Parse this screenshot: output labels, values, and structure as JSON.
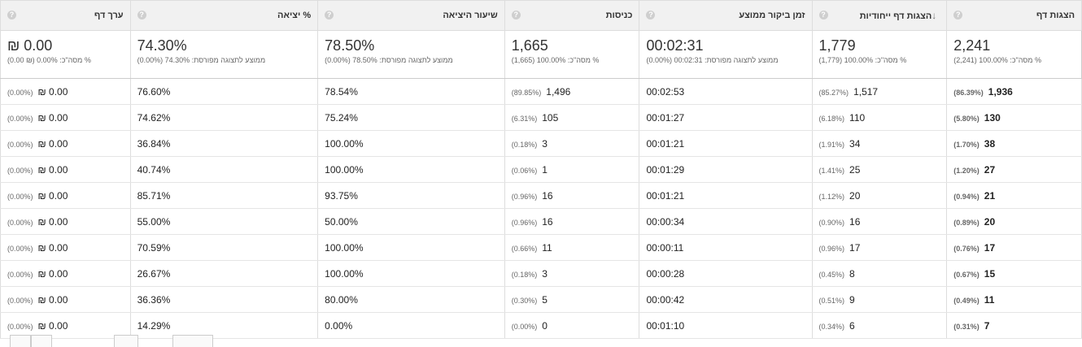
{
  "headers": {
    "pageviews": "הצגות דף",
    "unique": "הצגות דף ייחודיות",
    "avg_time": "זמן ביקור ממוצע",
    "entrances": "כניסות",
    "bounce": "שיעור היציאה",
    "exit": "% יציאה",
    "value": "ערך דף"
  },
  "summary": {
    "pageviews": {
      "big": "2,241",
      "sub": "% מסה\"כ: 100.00% (2,241)"
    },
    "unique": {
      "big": "1,779",
      "sub": "% מסה\"כ: 100.00% (1,779)"
    },
    "avg_time": {
      "big": "00:02:31",
      "sub": "ממוצע לתצוגה מפורסת: 00:02:31 (0.00%)"
    },
    "entrances": {
      "big": "1,665",
      "sub": "% מסה\"כ: 100.00% (1,665)"
    },
    "bounce": {
      "big": "78.50%",
      "sub": "ממוצע לתצוגה מפורסת: 78.50% (0.00%)"
    },
    "exit": {
      "big": "74.30%",
      "sub": "ממוצע לתצוגה מפורסת: 74.30% (0.00%)"
    },
    "value": {
      "big": "₪ 0.00",
      "sub": "% מסה\"כ: 0.00% (₪ 0.00)"
    }
  },
  "rows": [
    {
      "pv": "1,936",
      "pvp": "(86.39%)",
      "u": "1,517",
      "up": "(85.27%)",
      "t": "00:02:53",
      "e": "1,496",
      "ep": "(89.85%)",
      "b": "78.54%",
      "x": "76.60%",
      "v": "₪ 0.00",
      "vp": "(0.00%)"
    },
    {
      "pv": "130",
      "pvp": "(5.80%)",
      "u": "110",
      "up": "(6.18%)",
      "t": "00:01:27",
      "e": "105",
      "ep": "(6.31%)",
      "b": "75.24%",
      "x": "74.62%",
      "v": "₪ 0.00",
      "vp": "(0.00%)"
    },
    {
      "pv": "38",
      "pvp": "(1.70%)",
      "u": "34",
      "up": "(1.91%)",
      "t": "00:01:21",
      "e": "3",
      "ep": "(0.18%)",
      "b": "100.00%",
      "x": "36.84%",
      "v": "₪ 0.00",
      "vp": "(0.00%)"
    },
    {
      "pv": "27",
      "pvp": "(1.20%)",
      "u": "25",
      "up": "(1.41%)",
      "t": "00:01:29",
      "e": "1",
      "ep": "(0.06%)",
      "b": "100.00%",
      "x": "40.74%",
      "v": "₪ 0.00",
      "vp": "(0.00%)"
    },
    {
      "pv": "21",
      "pvp": "(0.94%)",
      "u": "20",
      "up": "(1.12%)",
      "t": "00:01:21",
      "e": "16",
      "ep": "(0.96%)",
      "b": "93.75%",
      "x": "85.71%",
      "v": "₪ 0.00",
      "vp": "(0.00%)"
    },
    {
      "pv": "20",
      "pvp": "(0.89%)",
      "u": "16",
      "up": "(0.90%)",
      "t": "00:00:34",
      "e": "16",
      "ep": "(0.96%)",
      "b": "50.00%",
      "x": "55.00%",
      "v": "₪ 0.00",
      "vp": "(0.00%)"
    },
    {
      "pv": "17",
      "pvp": "(0.76%)",
      "u": "17",
      "up": "(0.96%)",
      "t": "00:00:11",
      "e": "11",
      "ep": "(0.66%)",
      "b": "100.00%",
      "x": "70.59%",
      "v": "₪ 0.00",
      "vp": "(0.00%)"
    },
    {
      "pv": "15",
      "pvp": "(0.67%)",
      "u": "8",
      "up": "(0.45%)",
      "t": "00:00:28",
      "e": "3",
      "ep": "(0.18%)",
      "b": "100.00%",
      "x": "26.67%",
      "v": "₪ 0.00",
      "vp": "(0.00%)"
    },
    {
      "pv": "11",
      "pvp": "(0.49%)",
      "u": "9",
      "up": "(0.51%)",
      "t": "00:00:42",
      "e": "5",
      "ep": "(0.30%)",
      "b": "80.00%",
      "x": "36.36%",
      "v": "₪ 0.00",
      "vp": "(0.00%)"
    },
    {
      "pv": "7",
      "pvp": "(0.31%)",
      "u": "6",
      "up": "(0.34%)",
      "t": "00:01:10",
      "e": "0",
      "ep": "(0.00%)",
      "b": "0.00%",
      "x": "14.29%",
      "v": "₪ 0.00",
      "vp": "(0.00%)"
    }
  ],
  "icons": {
    "help": "help-icon",
    "sort": "sort-desc-arrow-icon"
  }
}
